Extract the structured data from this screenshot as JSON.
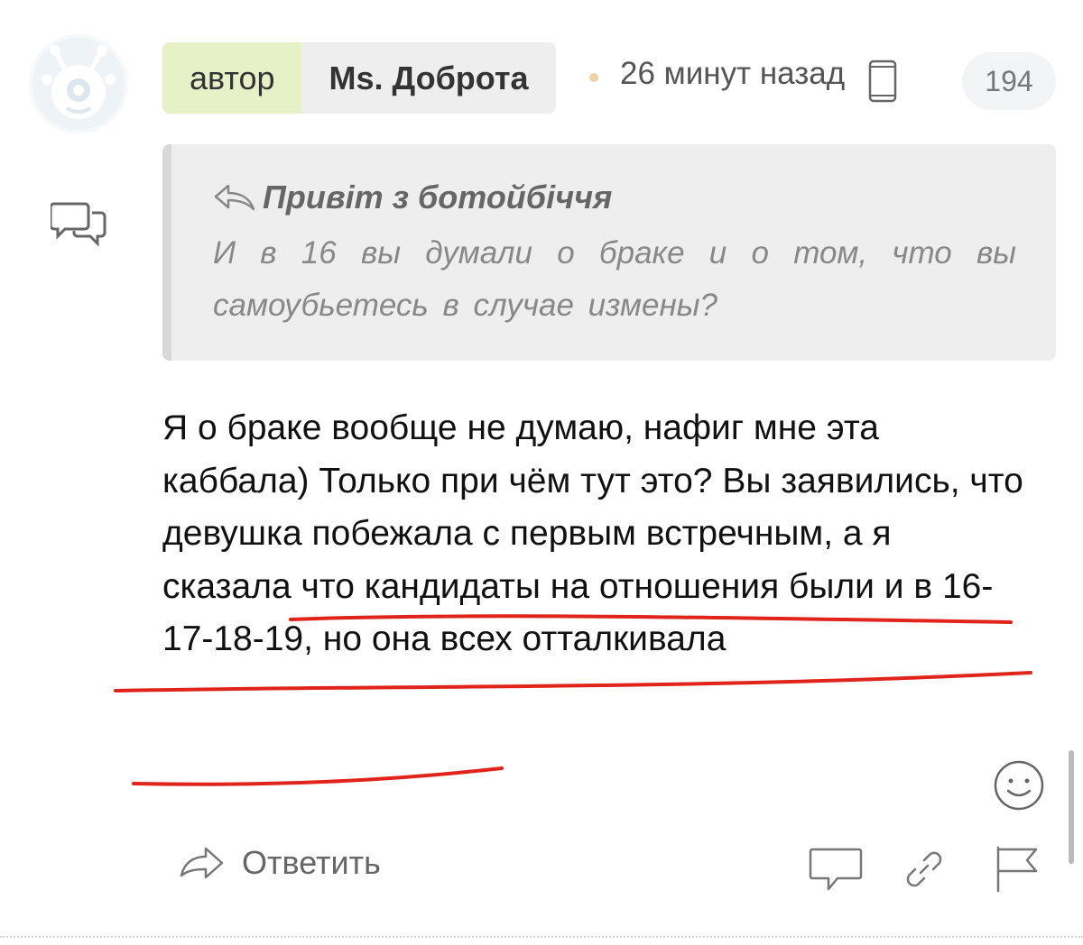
{
  "comment": {
    "author_tag": "автор",
    "author_name": "Ms. Доброта",
    "timestamp": "26 минут назад",
    "rating": "194",
    "quote": {
      "author": "Привіт з ботойбіччя",
      "text": "И в 16 вы думали о браке и о том, что вы самоубьетесь в случае измены?"
    },
    "body": "Я о браке вообще не думаю, нафиг мне эта каббала) Только при чём тут это? Вы заявились, что девушка побежала с первым встречным, а я сказала что кандидаты на отношения были и в 16-17-18-19, но она всех отталкивала"
  },
  "actions": {
    "reply_label": "Ответить"
  },
  "icons": {
    "avatar": "alien-avatar-icon",
    "comments": "speech-bubbles-icon",
    "device": "smartphone-icon",
    "quote": "reply-arrow-icon",
    "emoji": "smile-icon",
    "reply": "reply-arrow-icon",
    "comment": "speech-bubble-icon",
    "link": "link-icon",
    "flag": "flag-icon"
  },
  "colors": {
    "author_tag_bg": "#e6f1c8",
    "name_bg": "#eeeeee",
    "quote_bg": "#eeeeee",
    "annotation_red": "#e0231b"
  }
}
